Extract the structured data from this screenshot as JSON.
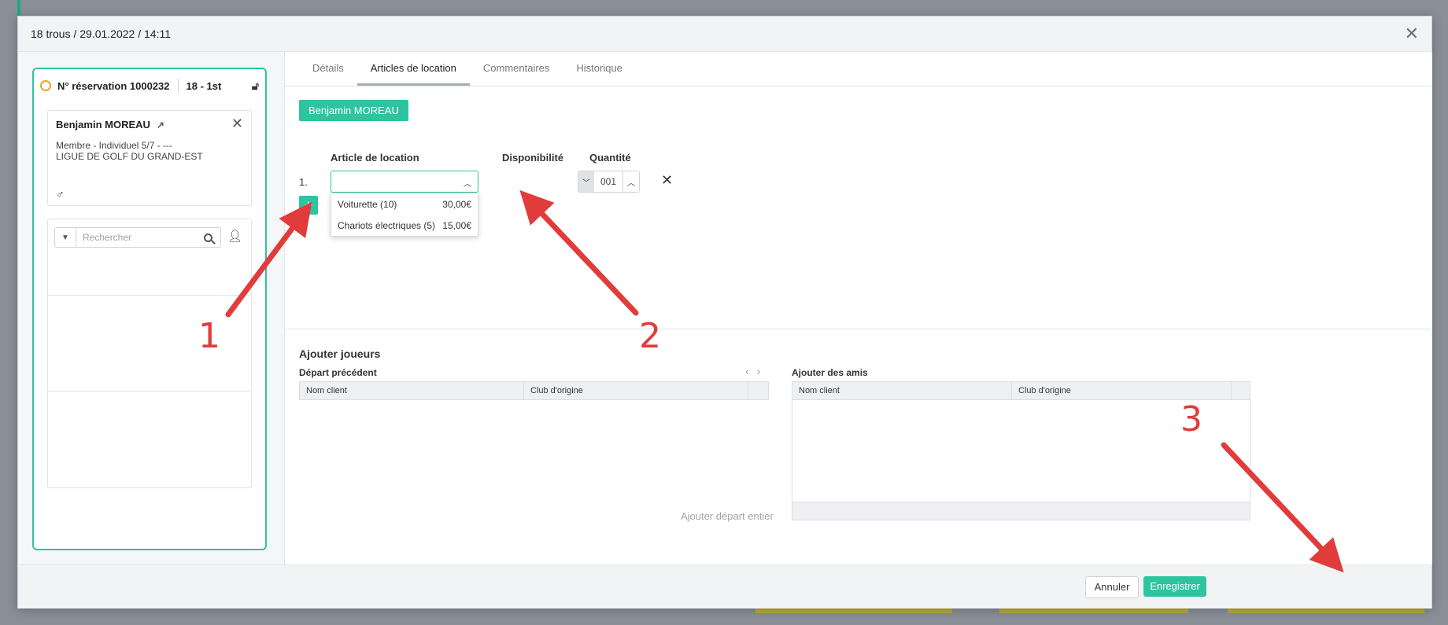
{
  "modal": {
    "title": "18 trous / 29.01.2022 / 14:11"
  },
  "booking": {
    "reservation_label": "N° réservation 1000232",
    "tee_label": "18 - 1st",
    "player": {
      "name": "Benjamin MOREAU",
      "membership": "Membre - Individuel 5/7 - ---",
      "league": "LIGUE DE GOLF DU GRAND-EST",
      "gender_symbol": "♂"
    },
    "search_placeholder": "Rechercher"
  },
  "tabs": [
    {
      "label": "Détails",
      "active": false
    },
    {
      "label": "Articles de location",
      "active": true
    },
    {
      "label": "Commentaires",
      "active": false
    },
    {
      "label": "Historique",
      "active": false
    }
  ],
  "rental": {
    "player_chip": "Benjamin MOREAU",
    "col_article": "Article de location",
    "col_availability": "Disponibilité",
    "col_quantity": "Quantité",
    "row_number": "1.",
    "quantity_value": "001",
    "options": [
      {
        "name": "Voiturette (10)",
        "price": "30,00€"
      },
      {
        "name": "Chariots électriques (5)",
        "price": "15,00€"
      }
    ]
  },
  "players": {
    "title": "Ajouter joueurs",
    "previous_title": "Départ précédent",
    "friends_title": "Ajouter des amis",
    "col_client": "Nom client",
    "col_club": "Club d'origine",
    "add_all": "Ajouter départ entier"
  },
  "footer": {
    "cancel": "Annuler",
    "save": "Enregistrer"
  },
  "callouts": [
    "1",
    "2",
    "3"
  ],
  "colors": {
    "accent": "#2ec4a0",
    "arrow": "#e23b3b",
    "globe": "#f0a330"
  }
}
